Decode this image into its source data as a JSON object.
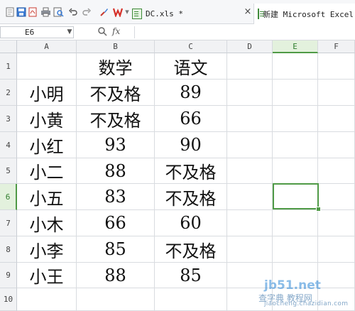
{
  "toolbar": {
    "icons": [
      "new-doc-icon",
      "save-icon",
      "pdf-icon",
      "print-icon",
      "print-preview-icon",
      "undo-icon",
      "redo-icon",
      "brush-icon",
      "wps-icon"
    ],
    "tab_file": "DC.xls *",
    "tab_close": "×",
    "tab_new": "新建 Microsoft Excel 工"
  },
  "formula_bar": {
    "cell_ref": "E6",
    "fx_label": "fx",
    "formula": ""
  },
  "sheet": {
    "columns": [
      "A",
      "B",
      "C",
      "D",
      "E",
      "F"
    ],
    "rows": [
      "1",
      "2",
      "3",
      "4",
      "5",
      "6",
      "7",
      "8",
      "9",
      "10"
    ],
    "selected_cell": "E6",
    "data": [
      [
        "",
        "数学",
        "语文"
      ],
      [
        "小明",
        "不及格",
        "89"
      ],
      [
        "小黄",
        "不及格",
        "66"
      ],
      [
        "小红",
        "93",
        "90"
      ],
      [
        "小二",
        "88",
        "不及格"
      ],
      [
        "小五",
        "83",
        "不及格"
      ],
      [
        "小木",
        "66",
        "60"
      ],
      [
        "小李",
        "85",
        "不及格"
      ],
      [
        "小王",
        "88",
        "85"
      ],
      [
        "",
        "",
        ""
      ]
    ]
  },
  "watermark": {
    "line1": "jb51.net",
    "line2": "查字典 教程网",
    "line3": "jiaocheng.chazidian.com"
  },
  "colors": {
    "accent": "#4f9a46",
    "header_bg": "#f1f2f4",
    "grid": "#d9dce0"
  }
}
